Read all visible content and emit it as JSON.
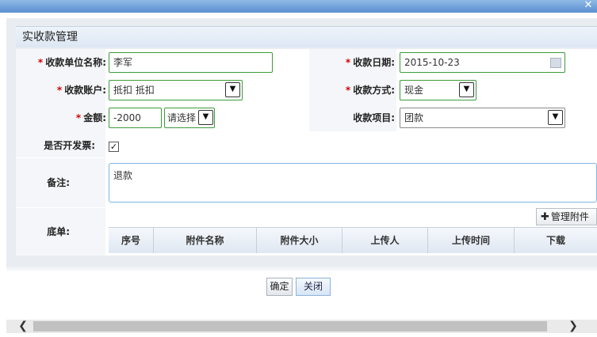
{
  "window": {
    "close_glyph": "✕"
  },
  "form": {
    "title": "实收款管理",
    "unit_name": {
      "label": "收款单位名称:",
      "value": "李军"
    },
    "date": {
      "label": "收款日期:",
      "value": "2015-10-23"
    },
    "account": {
      "label": "收款账户:",
      "value": "抵扣 抵扣"
    },
    "method": {
      "label": "收款方式:",
      "value": "现金"
    },
    "amount": {
      "label": "金额:",
      "value": "-2000",
      "currency_select": "请选择"
    },
    "project": {
      "label": "收款项目:",
      "value": "团款"
    },
    "invoice": {
      "label": "是否开发票:",
      "checked": true,
      "check_glyph": "✓"
    },
    "remark": {
      "label": "备注:",
      "value": "退款"
    },
    "attachments": {
      "label": "底单:",
      "manage_button": "管理附件",
      "plus_glyph": "✚",
      "columns": [
        "序号",
        "附件名称",
        "附件大小",
        "上传人",
        "上传时间",
        "下载"
      ]
    },
    "required_mark": "*"
  },
  "footer": {
    "ok": "确定",
    "close": "关闭"
  },
  "scrollbar": {
    "left_glyph": "❮",
    "right_glyph": "❯"
  },
  "colors": {
    "field_border": "#3c9b3c",
    "required": "#d40000",
    "title_bar": "#5b8fd0"
  }
}
